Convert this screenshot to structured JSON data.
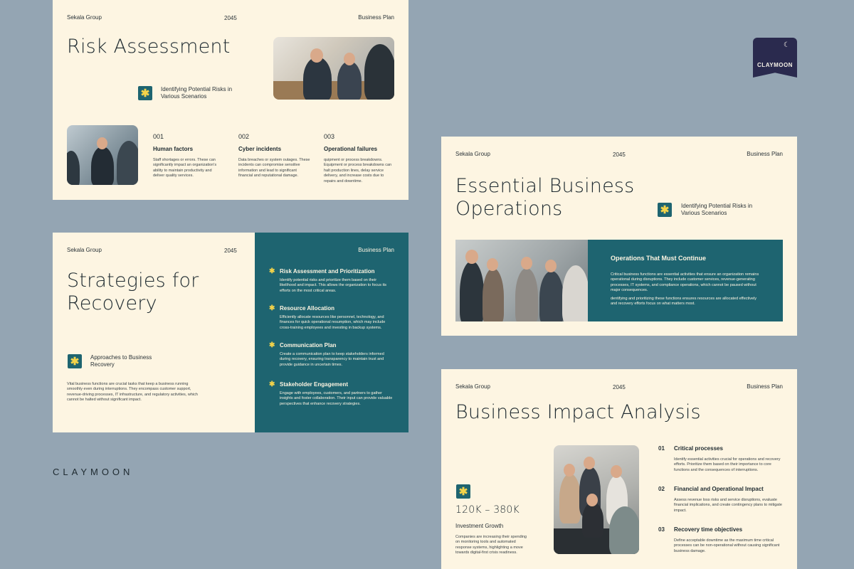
{
  "common": {
    "brand": "Sekala Group",
    "year": "2045",
    "doc": "Business Plan"
  },
  "slide1": {
    "title": "Risk Assessment",
    "subtitle": "Identifying Potential Risks in Various Scenarios",
    "items": [
      {
        "num": "001",
        "title": "Human factors",
        "desc": "Staff shortages or errors. These can significantly impact an organization's ability to maintain productivity and deliver quality services."
      },
      {
        "num": "002",
        "title": "Cyber incidents",
        "desc": "Data breaches or system outages. These incidents can compromise sensitive information and lead to significant financial and reputational damage."
      },
      {
        "num": "003",
        "title": "Operational failures",
        "desc": "quipment or process breakdowns. Equipment or process breakdowns can halt production lines, delay service delivery, and increase costs due to repairs and downtime."
      }
    ]
  },
  "slide2": {
    "title": "Strategies for Recovery",
    "subtitle": "Approaches to Business Recovery",
    "body": "Vital business functions are crucial tasks that keep a business running smoothly even during interruptions. They encompass customer support, revenue-driving processes, IT infrastructure, and regulatory activities, which cannot be halted without significant impact.",
    "items": [
      {
        "title": "Risk Assessment and Prioritization",
        "desc": "Identify potential risks and prioritize them based on their likelihood and impact. This allows the organization to focus its efforts on the most critical areas."
      },
      {
        "title": "Resource Allocation",
        "desc": "Efficiently allocate resources like personnel, technology, and finances for quick operational resumption, which may include cross-training employees and investing in backup systems."
      },
      {
        "title": "Communication Plan",
        "desc": "Create a communication plan to keep stakeholders informed during recovery, ensuring transparency to maintain trust and provide guidance in uncertain times."
      },
      {
        "title": "Stakeholder Engagement",
        "desc": "Engage with employees, customers, and partners to gather insights and foster collaboration. Their input can provide valuable perspectives that enhance recovery strategies."
      }
    ]
  },
  "slide3": {
    "title": "Essential Business Operations",
    "subtitle": "Identifying Potential Risks in Various Scenarios",
    "panel_title": "Operations That Must Continue",
    "panel_p1": "Critical business functions are essential activities that ensure an organization remains operational during disruptions. They include customer services, revenue-generating processes, IT systems, and compliance operations, which cannot be paused without major consequences.",
    "panel_p2": "dentifying and prioritizing these functions ensures resources are allocated effectively and recovery efforts focus on what matters most."
  },
  "slide4": {
    "title": "Business Impact Analysis",
    "range": "120K – 380K",
    "range_label": "Investment Growth",
    "body": "Companies are increasing their spending on monitoring tools and automated response systems, highlighting a move towards digital-first crisis readiness.",
    "items": [
      {
        "num": "01",
        "title": "Critical processes",
        "desc": "Identify essential activities crucial for operations and recovery efforts. Prioritize them based on their importance to core functions and the consequences of interruptions."
      },
      {
        "num": "02",
        "title": "Financial  and Operational Impact",
        "desc": "Assess revenue loss risks and service disruptions, evaluate financial implications, and create contingency plans to mitigate impact."
      },
      {
        "num": "03",
        "title": "Recovery time objectives",
        "desc": "Define acceptable downtime as the maximum time critical processes can be non-operational without causing significant business damage."
      }
    ]
  },
  "brand_logo": {
    "text": "CLAYMOON"
  },
  "footer_brand": "CLAYMOON",
  "colors": {
    "background": "#94a5b3",
    "slide": "#fdf5e2",
    "teal": "#1e6470",
    "accent": "#f3d34a"
  }
}
